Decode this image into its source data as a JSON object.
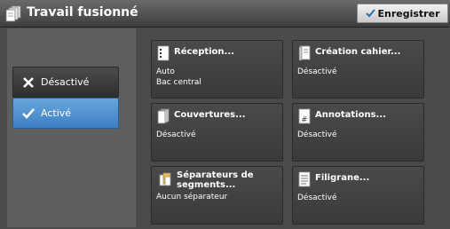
{
  "header": {
    "title": "Travail fusionné",
    "save_label": "Enregistrer"
  },
  "side": {
    "options": [
      {
        "label": "Désactivé",
        "selected": false
      },
      {
        "label": "Activé",
        "selected": true
      }
    ]
  },
  "tiles": {
    "reception": {
      "title": "Réception...",
      "value1": "Auto",
      "value2": "Bac central"
    },
    "creation_cahier": {
      "title": "Création cahier...",
      "value1": "Désactivé"
    },
    "couvertures": {
      "title": "Couvertures...",
      "value1": "Désactivé"
    },
    "annotations": {
      "title": "Annotations...",
      "value1": "Désactivé"
    },
    "separateurs": {
      "title_line1": "Séparateurs de",
      "title_line2": "segments...",
      "value1": "Aucun séparateur"
    },
    "filigrane": {
      "title": "Filigrane...",
      "value1": "Désactivé"
    }
  },
  "colors": {
    "selected_blue": "#4a8fd0",
    "background": "#4a4a4a"
  }
}
